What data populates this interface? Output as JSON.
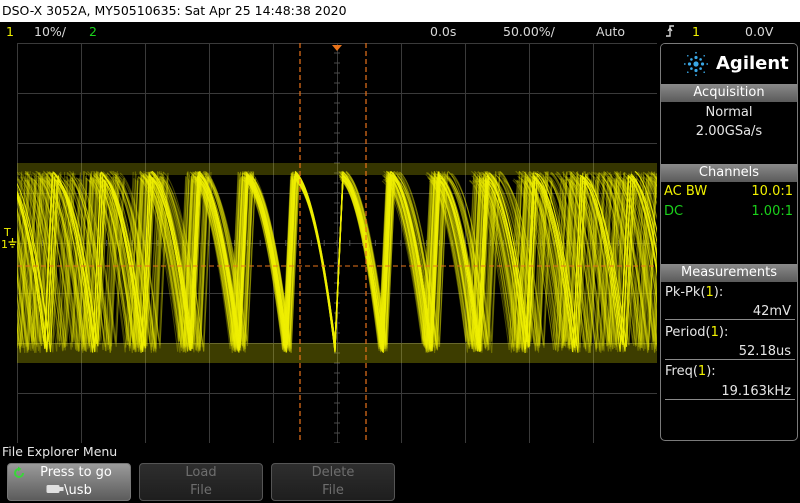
{
  "title_bar": {
    "text": "DSO-X 3052A, MY50510635: Sat Apr 25 14:48:38 2020"
  },
  "status": {
    "ch1_num": "1",
    "ch1_scale": "10%/",
    "ch2_num": "2",
    "delay": "0.0s",
    "timebase": "50.00%/",
    "trigger_mode": "Auto",
    "trigger_icon": "rising-edge-icon",
    "trigger_source": "1",
    "trigger_level": "0.0V"
  },
  "brand": {
    "name": "Agilent"
  },
  "acquisition": {
    "header": "Acquisition",
    "mode": "Normal",
    "rate": "2.00GSa/s"
  },
  "channels": {
    "header": "Channels",
    "ch1": {
      "coupling": "AC BW",
      "probe": "10.0:1"
    },
    "ch2": {
      "coupling": "DC",
      "probe": "1.00:1"
    }
  },
  "measurements": {
    "header": "Measurements",
    "items": [
      {
        "label": "Pk-Pk",
        "src": "1",
        "value": "42mV"
      },
      {
        "label": "Period",
        "src": "1",
        "value": "52.18us"
      },
      {
        "label": "Freq",
        "src": "1",
        "value": "19.163kHz"
      }
    ]
  },
  "ground_marker": {
    "num": "1",
    "trig": "T"
  },
  "softkeys": {
    "menu_title": "File Explorer Menu",
    "press_to_go": {
      "line1": "Press to go",
      "line2": "\\usb"
    },
    "load": {
      "line1": "Load",
      "line2": "File"
    },
    "delete": {
      "line1": "Delete",
      "line2": "File"
    }
  },
  "colors": {
    "ch1": "#f2f200",
    "ch2": "#1bd11b",
    "grid": "#3a3a3a",
    "cursor": "#e8731a"
  }
}
